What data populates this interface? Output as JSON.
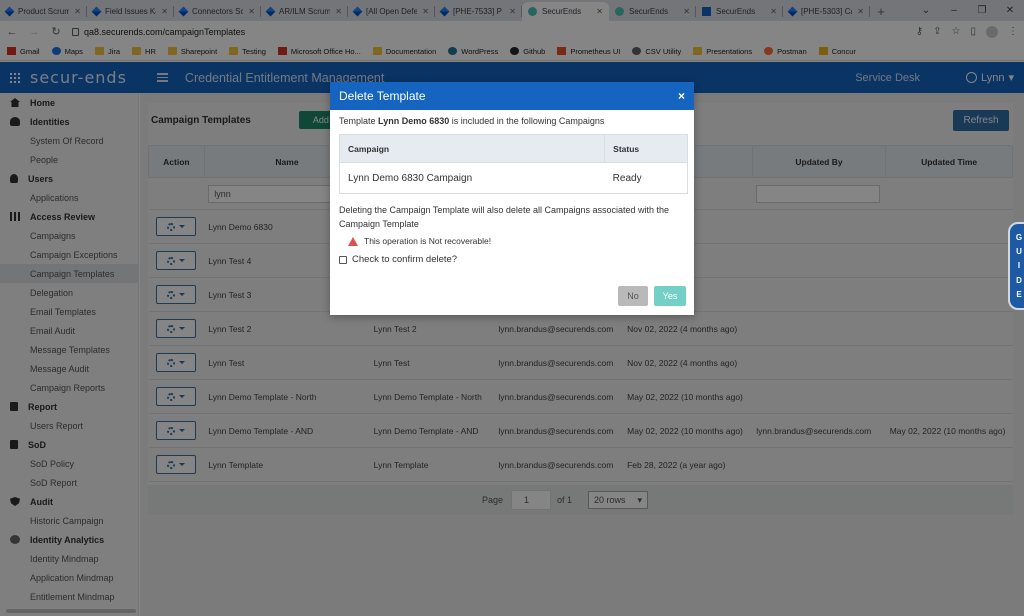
{
  "browser": {
    "tabs": [
      {
        "label": "Product Scrum",
        "icon": "jira"
      },
      {
        "label": "Field Issues Ka",
        "icon": "jira"
      },
      {
        "label": "Connectors Sc",
        "icon": "jira"
      },
      {
        "label": "AR/ILM Scrum",
        "icon": "jira"
      },
      {
        "label": "[All Open Defe",
        "icon": "jira"
      },
      {
        "label": "[PHE-7533] P",
        "icon": "jira"
      },
      {
        "label": "SecurEnds",
        "icon": "se",
        "active": true
      },
      {
        "label": "SecurEnds",
        "icon": "se"
      },
      {
        "label": "SecurEnds",
        "icon": "se2"
      },
      {
        "label": "[PHE-5303] Ca",
        "icon": "jira"
      }
    ],
    "url": "qa8.securends.com/campaignTemplates",
    "bookmarks": [
      {
        "label": "Gmail",
        "icon": "red"
      },
      {
        "label": "Maps",
        "icon": "blue"
      },
      {
        "label": "Jira",
        "icon": "folder"
      },
      {
        "label": "HR",
        "icon": "folder"
      },
      {
        "label": "Sharepoint",
        "icon": "folder"
      },
      {
        "label": "Testing",
        "icon": "folder"
      },
      {
        "label": "Microsoft Office Ho...",
        "icon": "red"
      },
      {
        "label": "Documentation",
        "icon": "folder"
      },
      {
        "label": "WordPress",
        "icon": "wp"
      },
      {
        "label": "Github",
        "icon": "dark"
      },
      {
        "label": "Prometheus UI",
        "icon": "prom"
      },
      {
        "label": "CSV Utility",
        "icon": "csv"
      },
      {
        "label": "Presentations",
        "icon": "folder"
      },
      {
        "label": "Postman",
        "icon": "post"
      },
      {
        "label": "Concur",
        "icon": "concur"
      }
    ]
  },
  "app": {
    "logo": "secur-ends",
    "title": "Credential Entitlement Management",
    "service_desk": "Service Desk",
    "user": "Lynn",
    "accent": "#1565c0"
  },
  "sidebar": {
    "items": [
      {
        "label": "Home",
        "type": "section",
        "icon": "home"
      },
      {
        "label": "Identities",
        "type": "section",
        "icon": "users"
      },
      {
        "label": "System Of Record",
        "type": "item"
      },
      {
        "label": "People",
        "type": "item"
      },
      {
        "label": "Users",
        "type": "section",
        "icon": "user1"
      },
      {
        "label": "Applications",
        "type": "item"
      },
      {
        "label": "Access Review",
        "type": "section",
        "icon": "gridi"
      },
      {
        "label": "Campaigns",
        "type": "item"
      },
      {
        "label": "Campaign Exceptions",
        "type": "item"
      },
      {
        "label": "Campaign Templates",
        "type": "item",
        "active": true
      },
      {
        "label": "Delegation",
        "type": "item"
      },
      {
        "label": "Email Templates",
        "type": "item"
      },
      {
        "label": "Email Audit",
        "type": "item"
      },
      {
        "label": "Message Templates",
        "type": "item"
      },
      {
        "label": "Message Audit",
        "type": "item"
      },
      {
        "label": "Campaign Reports",
        "type": "item"
      },
      {
        "label": "Report",
        "type": "section",
        "icon": "doc"
      },
      {
        "label": "Users Report",
        "type": "item"
      },
      {
        "label": "SoD",
        "type": "section",
        "icon": "doc"
      },
      {
        "label": "SoD Policy",
        "type": "item"
      },
      {
        "label": "SoD Report",
        "type": "item"
      },
      {
        "label": "Audit",
        "type": "section",
        "icon": "shield"
      },
      {
        "label": "Historic Campaign",
        "type": "item"
      },
      {
        "label": "Identity Analytics",
        "type": "section",
        "icon": "dot"
      },
      {
        "label": "Identity Mindmap",
        "type": "item"
      },
      {
        "label": "Application Mindmap",
        "type": "item"
      },
      {
        "label": "Entitlement Mindmap",
        "type": "item"
      }
    ]
  },
  "page": {
    "title": "Campaign Templates",
    "add_label": "Add",
    "refresh_label": "Refresh",
    "columns": [
      "Action",
      "Name",
      "",
      "",
      "me",
      "Updated By",
      "Updated Time"
    ],
    "filter_name": "lynn",
    "rows": [
      {
        "name": "Lynn Demo 6830",
        "desc": "",
        "created_by": "",
        "created_time": "ago)",
        "updated_by": "",
        "updated_time": ""
      },
      {
        "name": "Lynn Test 4",
        "desc": "",
        "created_by": "",
        "created_time": "nths ago)",
        "updated_by": "",
        "updated_time": ""
      },
      {
        "name": "Lynn Test 3",
        "desc": "",
        "created_by": "",
        "created_time": "nths ago)",
        "updated_by": "",
        "updated_time": ""
      },
      {
        "name": "Lynn Test 2",
        "desc": "Lynn Test 2",
        "created_by": "lynn.brandus@securends.com",
        "created_time": "Nov 02, 2022 (4 months ago)",
        "updated_by": "",
        "updated_time": ""
      },
      {
        "name": "Lynn Test",
        "desc": "Lynn Test",
        "created_by": "lynn.brandus@securends.com",
        "created_time": "Nov 02, 2022 (4 months ago)",
        "updated_by": "",
        "updated_time": ""
      },
      {
        "name": "Lynn Demo Template - North",
        "desc": "Lynn Demo Template - North",
        "created_by": "lynn.brandus@securends.com",
        "created_time": "May 02, 2022 (10 months ago)",
        "updated_by": "",
        "updated_time": ""
      },
      {
        "name": "Lynn Demo Template - AND",
        "desc": "Lynn Demo Template - AND",
        "created_by": "lynn.brandus@securends.com",
        "created_time": "May 02, 2022 (10 months ago)",
        "updated_by": "lynn.brandus@securends.com",
        "updated_time": "May 02, 2022 (10 months ago)"
      },
      {
        "name": "Lynn Template",
        "desc": "Lynn Template",
        "created_by": "lynn.brandus@securends.com",
        "created_time": "Feb 28, 2022 (a year ago)",
        "updated_by": "",
        "updated_time": ""
      }
    ],
    "pager": {
      "page_label": "Page",
      "page": "1",
      "of_label": "of 1",
      "rows": "20 rows"
    },
    "guide": [
      "G",
      "U",
      "I",
      "D",
      "E"
    ]
  },
  "modal": {
    "title": "Delete Template",
    "close": "×",
    "msg_prefix": "Template",
    "template_name": "Lynn Demo 6830",
    "msg_suffix": "is included in the following Campaigns",
    "table_headers": [
      "Campaign",
      "Status"
    ],
    "table_rows": [
      {
        "campaign": "Lynn Demo 6830 Campaign",
        "status": "Ready"
      }
    ],
    "warning": "Deleting the Campaign Template will also delete all Campaigns associated with the Campaign Template",
    "alert": "This operation is Not recoverable!",
    "confirm_label": "Check to confirm delete?",
    "no_label": "No",
    "yes_label": "Yes"
  }
}
